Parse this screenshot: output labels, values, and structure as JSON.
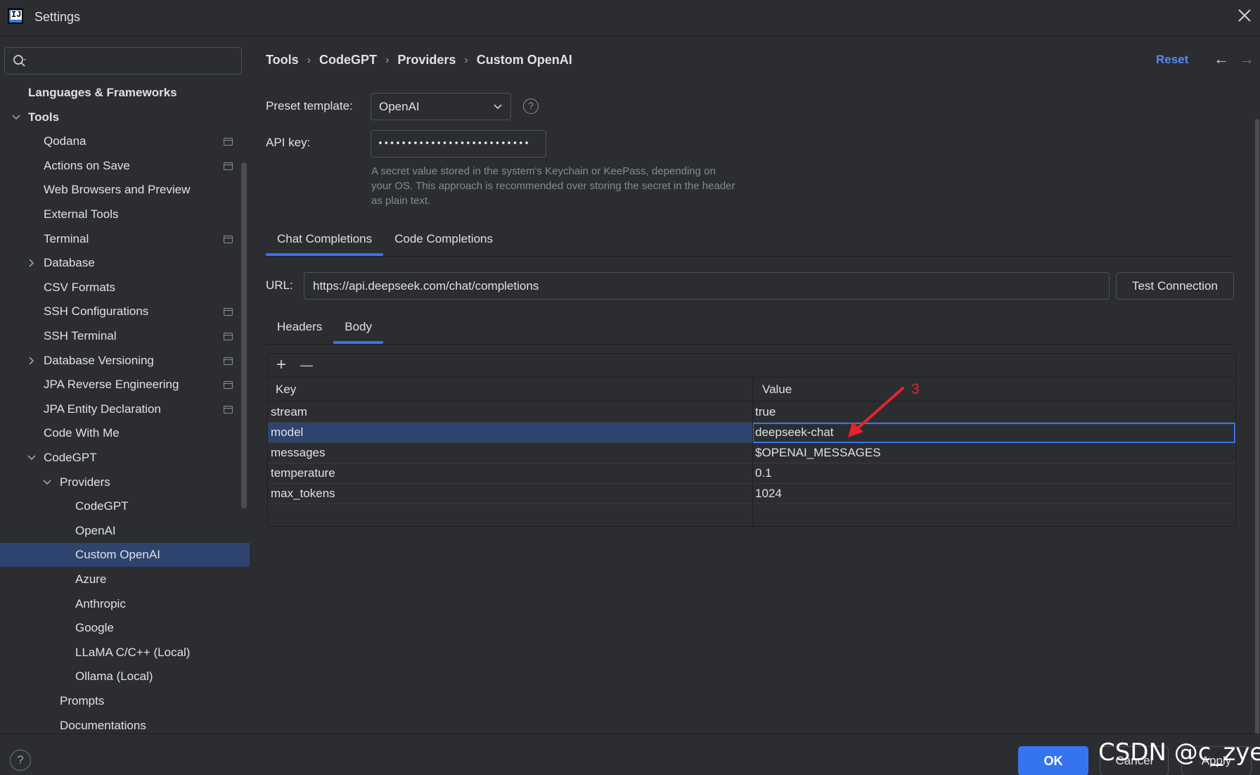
{
  "window": {
    "title": "Settings",
    "logo_text": "IJ"
  },
  "sidebar": {
    "search_placeholder": "",
    "items": [
      {
        "label": "Languages & Frameworks",
        "bold": true
      },
      {
        "label": "Tools",
        "bold": true,
        "expanded": true
      },
      {
        "label": "Qodana"
      },
      {
        "label": "Actions on Save"
      },
      {
        "label": "Web Browsers and Preview"
      },
      {
        "label": "External Tools"
      },
      {
        "label": "Terminal"
      },
      {
        "label": "Database",
        "collapsed": true
      },
      {
        "label": "CSV Formats"
      },
      {
        "label": "SSH Configurations"
      },
      {
        "label": "SSH Terminal"
      },
      {
        "label": "Database Versioning",
        "collapsed": true
      },
      {
        "label": "JPA Reverse Engineering"
      },
      {
        "label": "JPA Entity Declaration"
      },
      {
        "label": "Code With Me"
      },
      {
        "label": "CodeGPT",
        "expanded": true
      },
      {
        "label": "Providers",
        "expanded": true
      },
      {
        "label": "CodeGPT"
      },
      {
        "label": "OpenAI"
      },
      {
        "label": "Custom OpenAI",
        "selected": true
      },
      {
        "label": "Azure"
      },
      {
        "label": "Anthropic"
      },
      {
        "label": "Google"
      },
      {
        "label": "LLaMA C/C++ (Local)"
      },
      {
        "label": "Ollama (Local)"
      },
      {
        "label": "Prompts"
      },
      {
        "label": "Documentations"
      }
    ]
  },
  "header": {
    "breadcrumb": [
      "Tools",
      "CodeGPT",
      "Providers",
      "Custom OpenAI"
    ],
    "reset_label": "Reset",
    "back_arrow": "←",
    "forward_arrow": "→"
  },
  "form": {
    "preset_label": "Preset template:",
    "preset_value": "OpenAI",
    "api_key_label": "API key:",
    "api_key_value": "••••••••••••••••••••••••••",
    "api_key_help": "A secret value stored in the system's Keychain or KeePass, depending on your OS. This approach is recommended over storing the secret in the header as plain text.",
    "tabs": [
      "Chat Completions",
      "Code Completions"
    ],
    "active_tab": "Chat Completions",
    "url_label": "URL:",
    "url_value": "https://api.deepseek.com/chat/completions",
    "test_connection_label": "Test Connection",
    "subtabs": [
      "Headers",
      "Body"
    ],
    "active_subtab": "Body"
  },
  "table": {
    "add_icon": "+",
    "remove_icon": "—",
    "columns": [
      "Key",
      "Value"
    ],
    "rows": [
      {
        "key": "stream",
        "value": "true"
      },
      {
        "key": "model",
        "value": "deepseek-chat",
        "selected": true
      },
      {
        "key": "messages",
        "value": "$OPENAI_MESSAGES"
      },
      {
        "key": "temperature",
        "value": "0.1"
      },
      {
        "key": "max_tokens",
        "value": "1024"
      }
    ]
  },
  "annotation": {
    "number": "3",
    "color": "#e5242b"
  },
  "footer": {
    "help_label": "?",
    "ok_label": "OK",
    "cancel_label": "Cancel",
    "apply_label": "Apply",
    "watermark": "CSDN @c_zyer"
  },
  "colors": {
    "background": "#2b2d30",
    "accent": "#3574f0",
    "selection": "#2e436e",
    "link": "#548af7"
  }
}
